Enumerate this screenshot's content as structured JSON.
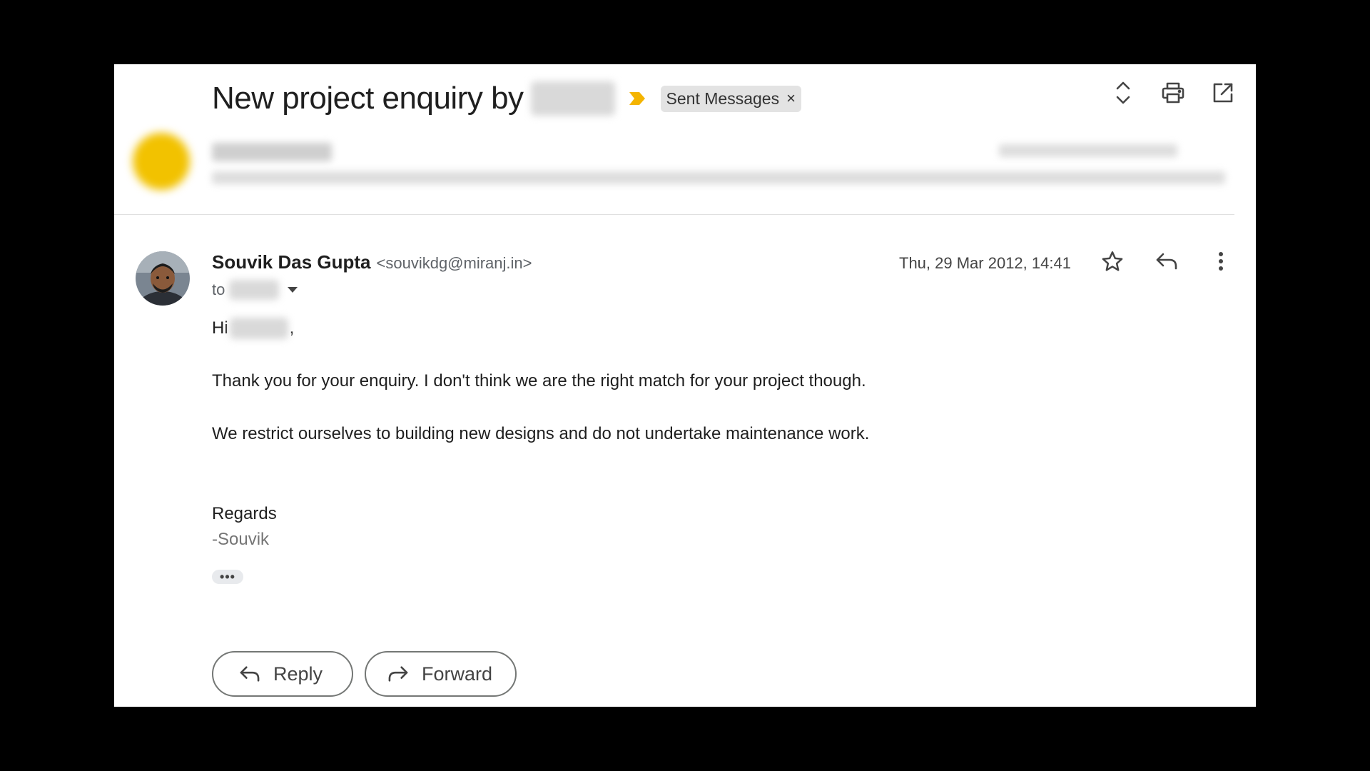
{
  "thread": {
    "subject": "New project enquiry by",
    "label": "Sent Messages",
    "label_close": "×"
  },
  "icons": {
    "importance": "importance-marker-icon",
    "expand": "expand-collapse-icon",
    "print": "print-icon",
    "open_new": "open-in-new-window-icon",
    "star": "star-icon",
    "reply": "reply-icon",
    "more": "more-vert-icon",
    "forward": "forward-icon"
  },
  "colors": {
    "importance": "#f4b400",
    "collapsed_avatar": "#f2c200",
    "chip_bg": "#e3e3e3"
  },
  "message": {
    "sender_name": "Souvik Das Gupta",
    "sender_email": "<souvikdg@miranj.in>",
    "to_label": "to",
    "date": "Thu, 29 Mar 2012, 14:41",
    "greeting": "Hi",
    "greeting_comma": ",",
    "paragraph_1": "Thank you for your enquiry. I don't think we are the right match for your project though.",
    "paragraph_2": "We restrict ourselves to building new designs and do not undertake maintenance work.",
    "regards": "Regards",
    "signature": "-Souvik",
    "trimmed_content": "•••"
  },
  "actions": {
    "reply": "Reply",
    "forward": "Forward"
  }
}
